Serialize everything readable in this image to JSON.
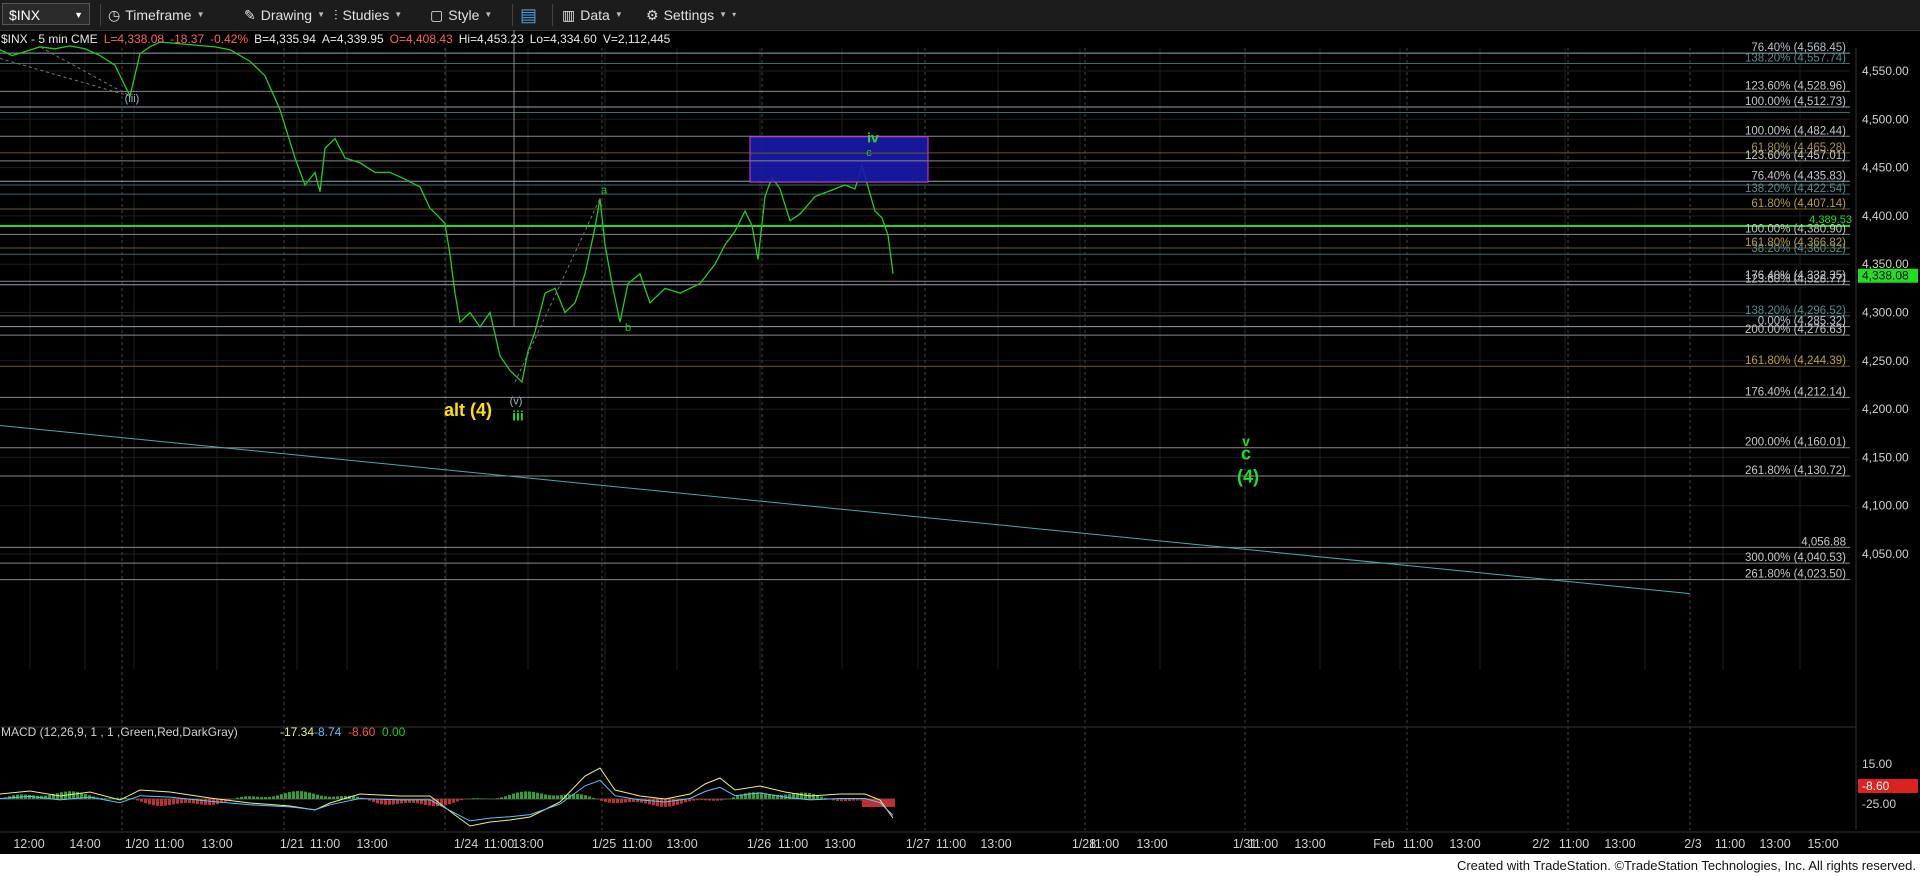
{
  "toolbar": {
    "symbol": "$INX",
    "timeframe": "Timeframe",
    "drawing": "Drawing",
    "studies": "Studies",
    "style": "Style",
    "data": "Data",
    "settings": "Settings"
  },
  "quote_line": {
    "title": "$INX - 5 min  CME",
    "last": "L=4,338.08",
    "change": "-18.37",
    "pct": "-0.42%",
    "bid": "B=4,335.94",
    "ask": "A=4,339.95",
    "open": "O=4,408.43",
    "high": "Hi=4,453.23",
    "low": "Lo=4,334.60",
    "volume": "V=2,112,445"
  },
  "price_axis": {
    "ticks": [
      "4,550.00",
      "4,500.00",
      "4,450.00",
      "4,400.00",
      "4,350.00",
      "4,300.00",
      "4,250.00",
      "4,200.00",
      "4,150.00",
      "4,100.00",
      "4,050.00"
    ],
    "last_price": "4,338.08",
    "marker": "4,389.53"
  },
  "fib_labels": [
    {
      "t": "76.40% (4,568.45)",
      "c": "#b8c0c8"
    },
    {
      "t": "138.20% (4,557.74)",
      "c": "#5a8a8a"
    },
    {
      "t": "123.60% (4,528.96)",
      "c": "#c8c8c8"
    },
    {
      "t": "100.00% (4,512.73)",
      "c": "#c0c8d0"
    },
    {
      "t": "100.00% (4,482.44)",
      "c": "#c8c8c8"
    },
    {
      "t": "61.80% (4,465.28)",
      "c": "#a89050"
    },
    {
      "t": "123.60% (4,457.01)",
      "c": "#c8c8c8"
    },
    {
      "t": "76.40% (4,435.83)",
      "c": "#c0c8d0"
    },
    {
      "t": "138.20% (4,422.54)",
      "c": "#5a8a8a"
    },
    {
      "t": "61.80% (4,407.14)",
      "c": "#b8a040"
    },
    {
      "t": "100.00% (4,380.90)",
      "c": "#c8c8c8"
    },
    {
      "t": "161.80% (4,366.82)",
      "c": "#b8a040"
    },
    {
      "t": "38.20% (4,360.32)",
      "c": "#5a8a8a"
    },
    {
      "t": "176.40% (4,332.35)",
      "c": "#c8c8c8"
    },
    {
      "t": "123.60% (4,328.77)",
      "c": "#c0c8d0"
    },
    {
      "t": "138.20% (4,296.52)",
      "c": "#5a8a8a"
    },
    {
      "t": "0.00% (4,285.32)",
      "c": "#c0c8d0"
    },
    {
      "t": "200.00% (4,276.63)",
      "c": "#c8c8c8"
    },
    {
      "t": "161.80% (4,244.39)",
      "c": "#b8a040"
    },
    {
      "t": "176.40% (4,212.14)",
      "c": "#c8c8c8"
    },
    {
      "t": "200.00% (4,160.01)",
      "c": "#c8c8c8"
    },
    {
      "t": "261.80% (4,130.72)",
      "c": "#c8c8c8"
    },
    {
      "t": "4,056.88",
      "c": "#c8c8c8"
    },
    {
      "t": "300.00% (4,040.53)",
      "c": "#c8c8c8"
    },
    {
      "t": "261.80% (4,023.50)",
      "c": "#c8c8c8"
    }
  ],
  "wave_labels": {
    "iii_small": "(iii)",
    "alt4": "alt (4)",
    "v_small": "(v)",
    "iii": "iii",
    "a": "a",
    "b": "b",
    "iv": "iv",
    "c_small": "c",
    "v": "v",
    "c": "c",
    "four": "(4)"
  },
  "macd": {
    "title": "MACD (12,26,9, 1 , 1 ,Green,Red,DarkGray)",
    "v1": "-17.34",
    "v2": "-8.74",
    "v3": "-8.60",
    "v4": "0.00",
    "axis": [
      "15.00",
      "-25.00"
    ],
    "last": "-8.60"
  },
  "time_axis": [
    "12:00",
    "14:00",
    "1/20",
    "11:00",
    "13:00",
    "1/21",
    "11:00",
    "13:00",
    "1/24",
    "11:00",
    "13:00",
    "1/25",
    "11:00",
    "13:00",
    "1/26",
    "11:00",
    "13:00",
    "1/27",
    "11:00",
    "13:00",
    "1/28",
    "11:00",
    "13:00",
    "1/31",
    "11:00",
    "13:00",
    "Feb",
    "11:00",
    "13:00",
    "2/2",
    "11:00",
    "13:00",
    "2/3",
    "11:00",
    "13:00",
    "15:00"
  ],
  "footer": "Created with TradeStation. ©TradeStation Technologies, Inc. All rights reserved.",
  "colors": {
    "green": "#22dd22",
    "yellow": "#ffe000",
    "box": "#1a1aa8",
    "macd_line": "#f0f080",
    "signal": "#60c0ff"
  }
}
